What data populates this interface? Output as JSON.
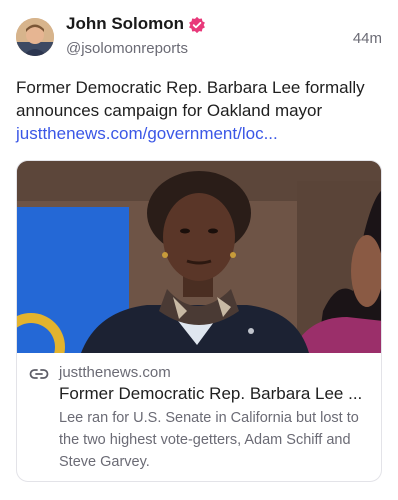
{
  "author": {
    "name": "John Solomon",
    "handle": "@jsolomonreports",
    "avatar_icon": "person-avatar",
    "verified_icon": "verified-badge-icon",
    "verified_color": "#e8397a"
  },
  "post": {
    "time": "44m",
    "text": "Former Democratic Rep. Barbara Lee formally announces campaign for Oakland mayor",
    "link_text": "justthenews.com/government/loc..."
  },
  "link_card": {
    "link_icon": "link-icon",
    "domain": "justthenews.com",
    "title": "Former Democratic Rep. Barbara Lee ...",
    "description": "Lee ran for U.S. Senate in California but lost to the two highest vote-getters, Adam Schiff and Steve Garvey."
  },
  "colors": {
    "link": "#3b57e6",
    "secondary_text": "#6b6b75"
  }
}
